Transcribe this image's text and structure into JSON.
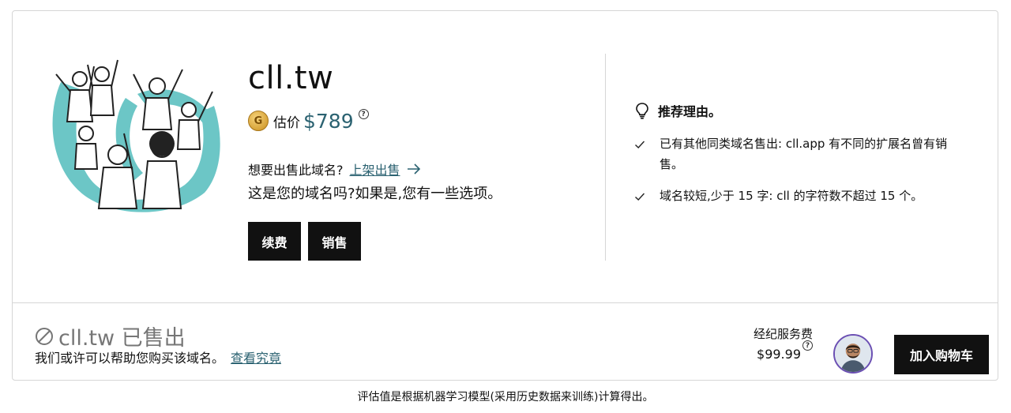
{
  "domain": {
    "name": "cll.tw",
    "valuation_label": "估价",
    "valuation_amount": "$789",
    "info_symbol": "?"
  },
  "sell": {
    "prompt": "想要出售此域名?",
    "link_label": "上架出售"
  },
  "owner": {
    "question": "这是您的域名吗?如果是,您有一些选项。",
    "renew_label": "续费",
    "sell_label": "销售"
  },
  "reasons": {
    "title": "推荐理由。",
    "items": [
      "已有其他同类域名售出: cll.app 有不同的扩展名曾有销售。",
      "域名较短,少于 15 字: cll 的字符数不超过 15 个。"
    ]
  },
  "sold": {
    "title": "cll.tw 已售出",
    "subtitle": "我们或许可以帮助您购买该域名。",
    "link_label": "查看究竟"
  },
  "broker": {
    "label": "经纪服务费",
    "price": "$99.99",
    "info_symbol": "?",
    "cart_label": "加入购物车"
  },
  "footer": {
    "note": "评估值是根据机器学习模型(采用历史数据来训练)计算得出。"
  },
  "colors": {
    "accent_teal": "#2b6271",
    "illustration_teal": "#6cc6c6",
    "dark_button": "#111111",
    "sold_gray": "#767676"
  },
  "icons": [
    "gold-coin-icon",
    "info-icon",
    "arrow-right-icon",
    "lightbulb-icon",
    "check-icon",
    "ban-icon"
  ]
}
